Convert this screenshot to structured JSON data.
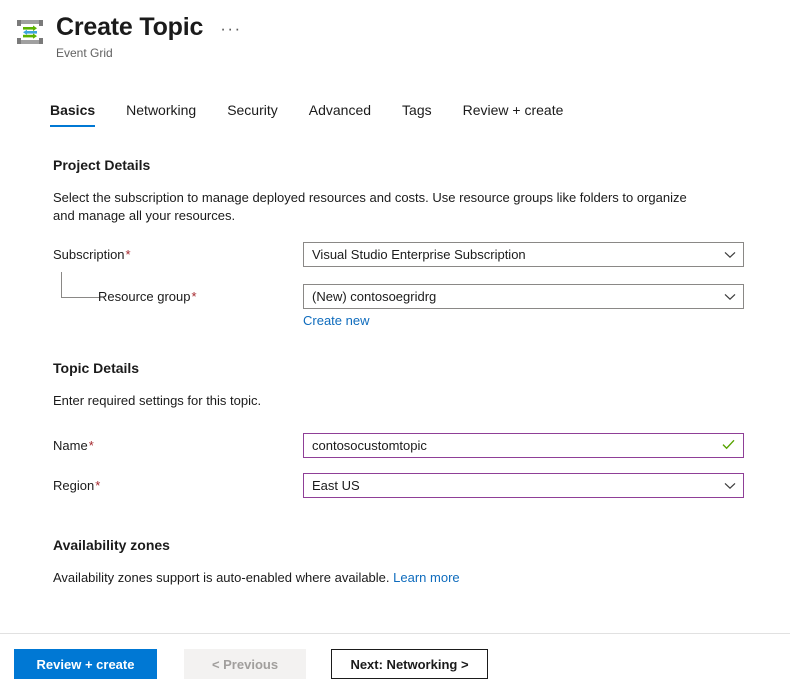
{
  "header": {
    "icon": "event-grid-icon",
    "title": "Create Topic",
    "subtitle": "Event Grid",
    "more_menu": "···"
  },
  "tabs": [
    {
      "label": "Basics",
      "active": true
    },
    {
      "label": "Networking",
      "active": false
    },
    {
      "label": "Security",
      "active": false
    },
    {
      "label": "Advanced",
      "active": false
    },
    {
      "label": "Tags",
      "active": false
    },
    {
      "label": "Review + create",
      "active": false
    }
  ],
  "project_details": {
    "heading": "Project Details",
    "description": "Select the subscription to manage deployed resources and costs. Use resource groups like folders to organize and manage all your resources.",
    "subscription": {
      "label": "Subscription",
      "required_marker": "*",
      "value": "Visual Studio Enterprise Subscription",
      "icon": "chevron-down-icon"
    },
    "resource_group": {
      "label": "Resource group",
      "required_marker": "*",
      "value": "(New) contosoegridrg",
      "icon": "chevron-down-icon",
      "create_new_link": "Create new"
    }
  },
  "topic_details": {
    "heading": "Topic Details",
    "description": "Enter required settings for this topic.",
    "name": {
      "label": "Name",
      "required_marker": "*",
      "value": "contosocustomtopic",
      "icon": "checkmark-icon",
      "state": "valid"
    },
    "region": {
      "label": "Region",
      "required_marker": "*",
      "value": "East US",
      "icon": "chevron-down-icon"
    }
  },
  "availability_zones": {
    "heading": "Availability zones",
    "description": "Availability zones support is auto-enabled where available.",
    "learn_more_link": "Learn more"
  },
  "footer": {
    "review_create": "Review + create",
    "previous": "< Previous",
    "next": "Next: Networking >"
  },
  "colors": {
    "accent": "#0078d4",
    "link": "#0f6cbd",
    "required": "#a4262c",
    "validated_border": "#8f3f97",
    "valid_check": "#57a300",
    "default_border": "#8a8886"
  }
}
